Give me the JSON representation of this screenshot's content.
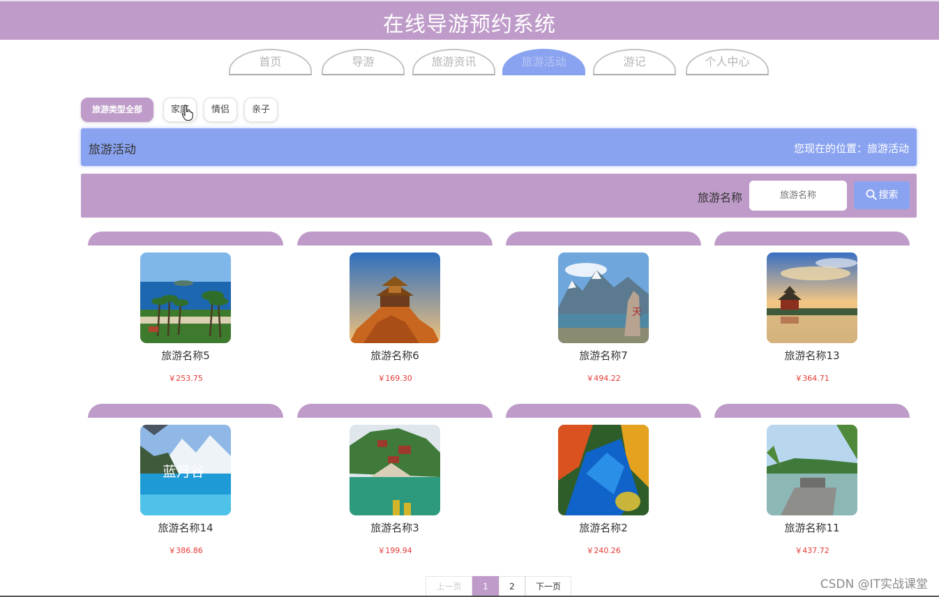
{
  "header": {
    "title": "在线导游预约系统"
  },
  "nav": {
    "tabs": [
      {
        "label": "首页",
        "active": false
      },
      {
        "label": "导游",
        "active": false
      },
      {
        "label": "旅游资讯",
        "active": false
      },
      {
        "label": "旅游活动",
        "active": true
      },
      {
        "label": "游记",
        "active": false
      },
      {
        "label": "个人中心",
        "active": false
      }
    ]
  },
  "filters": {
    "items": [
      {
        "label": "旅游类型全部",
        "active": true
      },
      {
        "label": "家庭",
        "active": false
      },
      {
        "label": "情侣",
        "active": false
      },
      {
        "label": "亲子",
        "active": false
      }
    ]
  },
  "breadcrumb": {
    "section": "旅游活动",
    "location": "您现在的位置：旅游活动"
  },
  "search": {
    "label": "旅游名称",
    "placeholder": "旅游名称",
    "button_label": "搜索"
  },
  "products": [
    {
      "name": "旅游名称5",
      "price": "￥253.75",
      "image": "beach-palms"
    },
    {
      "name": "旅游名称6",
      "price": "￥169.30",
      "image": "mountain-temple"
    },
    {
      "name": "旅游名称7",
      "price": "￥494.22",
      "image": "lake-statue"
    },
    {
      "name": "旅游名称13",
      "price": "￥364.71",
      "image": "pavilion-sunset"
    },
    {
      "name": "旅游名称14",
      "price": "￥386.86",
      "image": "blue-moon-valley"
    },
    {
      "name": "旅游名称3",
      "price": "￥199.94",
      "image": "riverside-temple"
    },
    {
      "name": "旅游名称2",
      "price": "￥240.26",
      "image": "autumn-lake"
    },
    {
      "name": "旅游名称11",
      "price": "￥437.72",
      "image": "lake-pier"
    }
  ],
  "pagination": {
    "prev_label": "上一页",
    "pages": [
      "1",
      "2"
    ],
    "current_page": "1",
    "next_label": "下一页"
  },
  "watermark": "CSDN @IT实战课堂",
  "colors": {
    "purple": "#bf9bc9",
    "blue": "#8aa3f0",
    "price_red": "#e53935"
  }
}
